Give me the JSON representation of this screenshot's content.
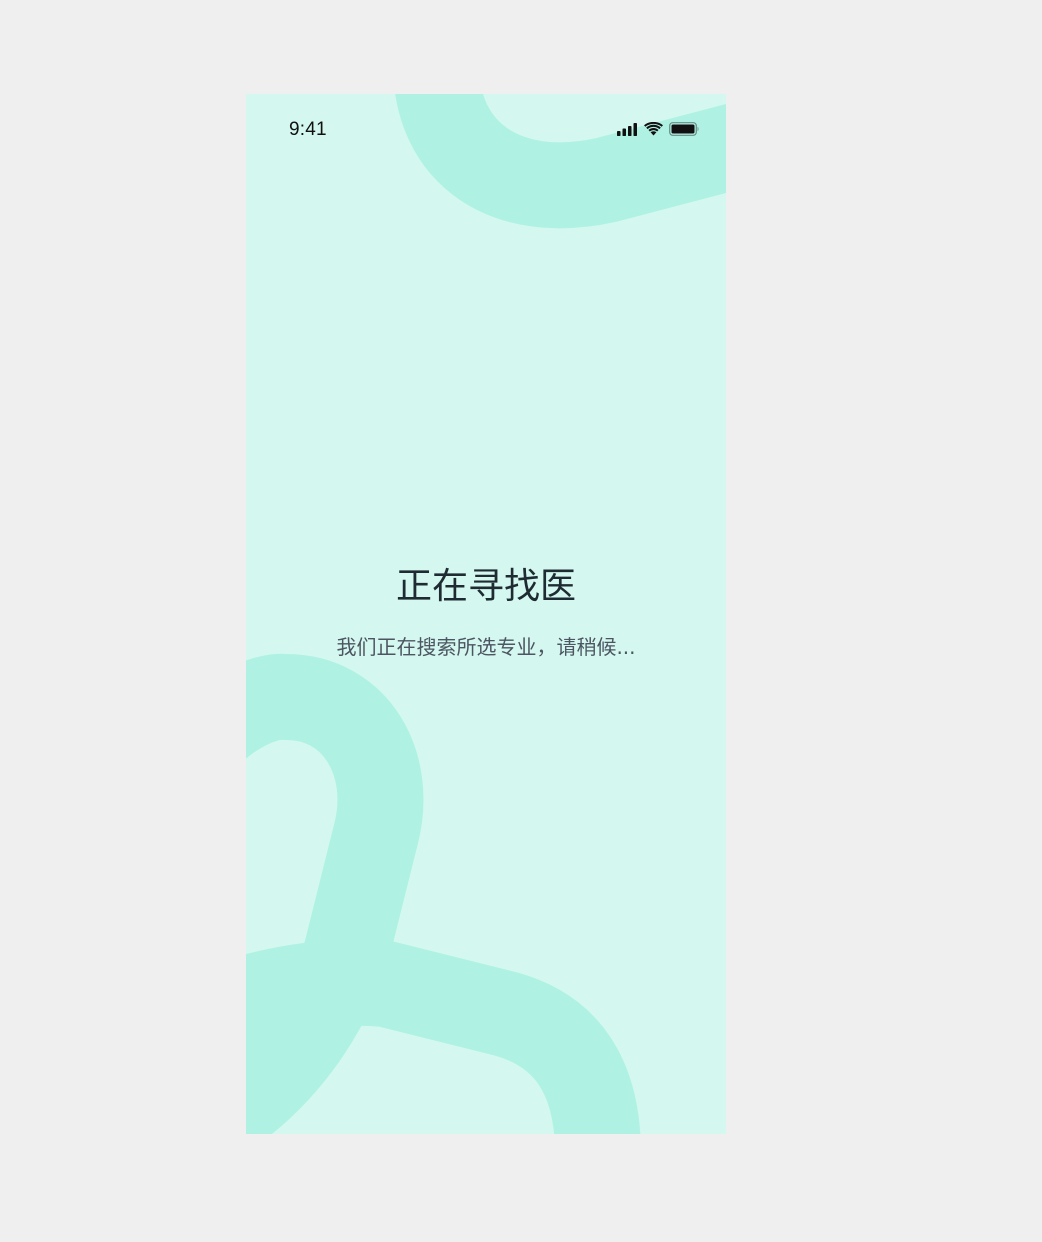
{
  "status_bar": {
    "time": "9:41",
    "icons": [
      "cellular-signal-icon",
      "wifi-icon",
      "battery-icon"
    ]
  },
  "loading": {
    "title": "正在寻找医",
    "subtitle": "我们正在搜索所选专业，请稍候..."
  },
  "colors": {
    "background": "#d4f8ef",
    "shape": "#aff2e3",
    "title": "#1e2b33",
    "subtitle": "#4c5561",
    "outer": "#efefef"
  }
}
